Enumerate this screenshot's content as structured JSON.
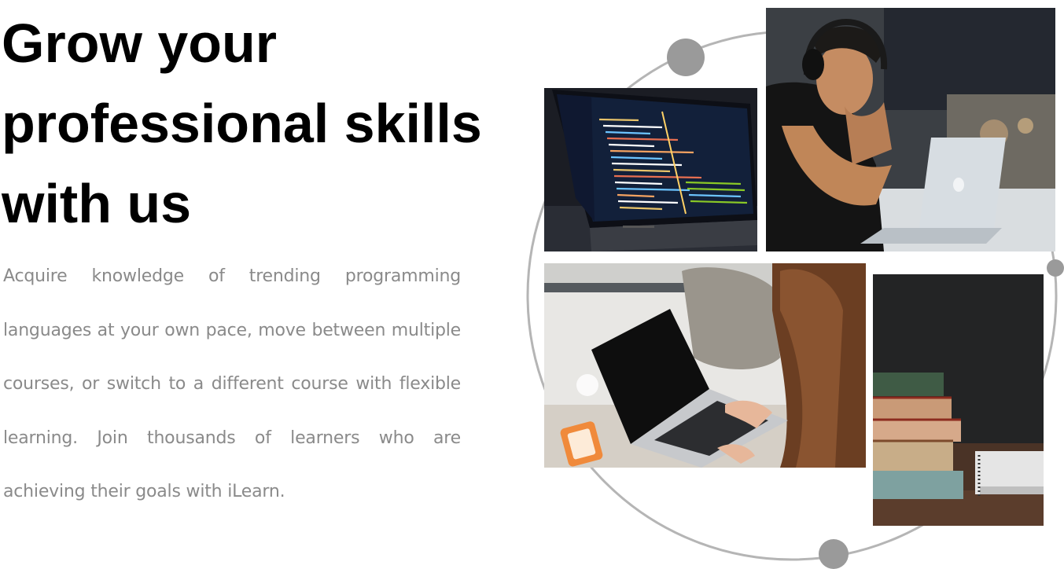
{
  "hero": {
    "title_lines": [
      "Grow your",
      "professional skills",
      "with us"
    ],
    "description": "Acquire knowledge of trending programming languages at your own pace, move between multiple courses, or switch to a different course with flexible learning. Join thousands of learners who are achieving their goals with iLearn."
  },
  "colors": {
    "title": "#000000",
    "description": "#8a8a8a",
    "orbit_ring": "#b5b5b5",
    "orbit_dot": "#9a9a9a"
  },
  "images": [
    {
      "name": "code-editor-laptop-photo"
    },
    {
      "name": "man-with-headphones-laptop-photo"
    },
    {
      "name": "woman-typing-laptop-photo"
    },
    {
      "name": "stacked-books-photo"
    }
  ]
}
